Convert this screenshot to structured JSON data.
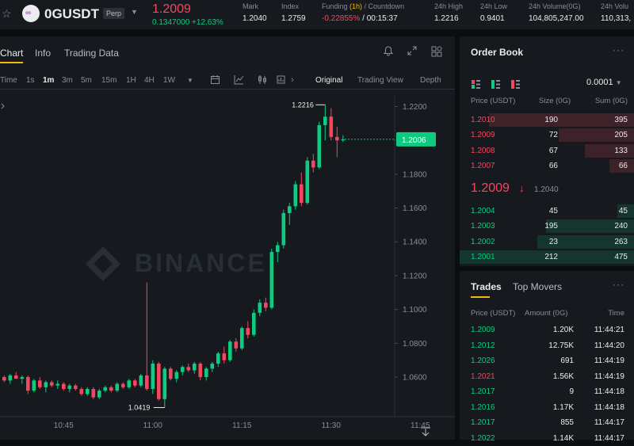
{
  "header": {
    "symbol": "0GUSDT",
    "contract_type": "Perp",
    "last_price": "1.2009",
    "change": "0.1347000 +12.63%",
    "stats": [
      {
        "label": "Mark",
        "value": "1.2040"
      },
      {
        "label": "Index",
        "value": "1.2759"
      },
      {
        "label_pre": "Funding ",
        "label_hl": "(1h)",
        "label_post": " / Countdown",
        "value": "-0.22855%",
        "value2": " / 00:15:37"
      },
      {
        "label": "24h High",
        "value": "1.2216"
      },
      {
        "label": "24h Low",
        "value": "0.9401"
      },
      {
        "label": "24h Volume(0G)",
        "value": "104,805,247.00"
      },
      {
        "label": "24h Volu",
        "value": "110,313,"
      }
    ]
  },
  "chart_panel": {
    "tabs": [
      "Chart",
      "Info",
      "Trading Data"
    ],
    "intervals": [
      "Time",
      "1s",
      "1m",
      "3m",
      "5m",
      "15m",
      "1H",
      "4H",
      "1W"
    ],
    "active_interval": "1m",
    "views": [
      "Original",
      "Trading View",
      "Depth"
    ],
    "active_view": "Original",
    "watermark": "BINANCE"
  },
  "chart_data": {
    "type": "candlestick",
    "interval": "1m",
    "y_ticks": [
      "1.2200",
      "1.2000",
      "1.1800",
      "1.1600",
      "1.1400",
      "1.1200",
      "1.1000",
      "1.0800",
      "1.0600"
    ],
    "x_ticks": [
      "10:45",
      "11:00",
      "11:15",
      "11:30",
      "11:45"
    ],
    "ylim": [
      1.0366,
      1.2263
    ],
    "current_price_label": "1.2006",
    "high_label": "1.2216",
    "low_label": "1.0419",
    "candles": [
      {
        "o": 1.06,
        "h": 1.061,
        "l": 1.057,
        "c": 1.058
      },
      {
        "o": 1.058,
        "h": 1.062,
        "l": 1.056,
        "c": 1.061
      },
      {
        "o": 1.061,
        "h": 1.063,
        "l": 1.059,
        "c": 1.059
      },
      {
        "o": 1.059,
        "h": 1.061,
        "l": 1.056,
        "c": 1.06
      },
      {
        "o": 1.06,
        "h": 1.061,
        "l": 1.05,
        "c": 1.052
      },
      {
        "o": 1.052,
        "h": 1.059,
        "l": 1.051,
        "c": 1.058
      },
      {
        "o": 1.058,
        "h": 1.06,
        "l": 1.053,
        "c": 1.054
      },
      {
        "o": 1.054,
        "h": 1.058,
        "l": 1.051,
        "c": 1.057
      },
      {
        "o": 1.057,
        "h": 1.058,
        "l": 1.054,
        "c": 1.055
      },
      {
        "o": 1.055,
        "h": 1.058,
        "l": 1.053,
        "c": 1.056
      },
      {
        "o": 1.056,
        "h": 1.057,
        "l": 1.052,
        "c": 1.053
      },
      {
        "o": 1.053,
        "h": 1.056,
        "l": 1.051,
        "c": 1.055
      },
      {
        "o": 1.055,
        "h": 1.056,
        "l": 1.052,
        "c": 1.053
      },
      {
        "o": 1.053,
        "h": 1.054,
        "l": 1.049,
        "c": 1.05
      },
      {
        "o": 1.05,
        "h": 1.054,
        "l": 1.049,
        "c": 1.053
      },
      {
        "o": 1.053,
        "h": 1.054,
        "l": 1.047,
        "c": 1.048
      },
      {
        "o": 1.048,
        "h": 1.053,
        "l": 1.047,
        "c": 1.052
      },
      {
        "o": 1.052,
        "h": 1.055,
        "l": 1.051,
        "c": 1.054
      },
      {
        "o": 1.054,
        "h": 1.055,
        "l": 1.051,
        "c": 1.052
      },
      {
        "o": 1.052,
        "h": 1.057,
        "l": 1.051,
        "c": 1.056
      },
      {
        "o": 1.056,
        "h": 1.057,
        "l": 1.053,
        "c": 1.054
      },
      {
        "o": 1.054,
        "h": 1.059,
        "l": 1.053,
        "c": 1.058
      },
      {
        "o": 1.058,
        "h": 1.059,
        "l": 1.054,
        "c": 1.055
      },
      {
        "o": 1.055,
        "h": 1.062,
        "l": 1.054,
        "c": 1.061
      },
      {
        "o": 1.061,
        "h": 1.116,
        "l": 1.052,
        "c": 1.053
      },
      {
        "o": 1.053,
        "h": 1.07,
        "l": 1.05,
        "c": 1.068
      },
      {
        "o": 1.068,
        "h": 1.069,
        "l": 1.046,
        "c": 1.047
      },
      {
        "o": 1.047,
        "h": 1.066,
        "l": 1.042,
        "c": 1.065
      },
      {
        "o": 1.065,
        "h": 1.066,
        "l": 1.058,
        "c": 1.059
      },
      {
        "o": 1.059,
        "h": 1.064,
        "l": 1.057,
        "c": 1.063
      },
      {
        "o": 1.063,
        "h": 1.067,
        "l": 1.061,
        "c": 1.066
      },
      {
        "o": 1.066,
        "h": 1.068,
        "l": 1.063,
        "c": 1.064
      },
      {
        "o": 1.064,
        "h": 1.069,
        "l": 1.062,
        "c": 1.068
      },
      {
        "o": 1.068,
        "h": 1.069,
        "l": 1.058,
        "c": 1.06
      },
      {
        "o": 1.06,
        "h": 1.066,
        "l": 1.058,
        "c": 1.065
      },
      {
        "o": 1.065,
        "h": 1.069,
        "l": 1.063,
        "c": 1.068
      },
      {
        "o": 1.068,
        "h": 1.075,
        "l": 1.066,
        "c": 1.074
      },
      {
        "o": 1.074,
        "h": 1.078,
        "l": 1.068,
        "c": 1.07
      },
      {
        "o": 1.07,
        "h": 1.082,
        "l": 1.069,
        "c": 1.081
      },
      {
        "o": 1.081,
        "h": 1.083,
        "l": 1.075,
        "c": 1.077
      },
      {
        "o": 1.077,
        "h": 1.09,
        "l": 1.076,
        "c": 1.089
      },
      {
        "o": 1.089,
        "h": 1.093,
        "l": 1.083,
        "c": 1.085
      },
      {
        "o": 1.085,
        "h": 1.1,
        "l": 1.084,
        "c": 1.098
      },
      {
        "o": 1.098,
        "h": 1.106,
        "l": 1.096,
        "c": 1.104
      },
      {
        "o": 1.104,
        "h": 1.107,
        "l": 1.099,
        "c": 1.101
      },
      {
        "o": 1.101,
        "h": 1.136,
        "l": 1.1,
        "c": 1.134
      },
      {
        "o": 1.134,
        "h": 1.14,
        "l": 1.128,
        "c": 1.138
      },
      {
        "o": 1.138,
        "h": 1.159,
        "l": 1.136,
        "c": 1.157
      },
      {
        "o": 1.157,
        "h": 1.163,
        "l": 1.15,
        "c": 1.161
      },
      {
        "o": 1.161,
        "h": 1.176,
        "l": 1.159,
        "c": 1.174
      },
      {
        "o": 1.174,
        "h": 1.181,
        "l": 1.161,
        "c": 1.163
      },
      {
        "o": 1.163,
        "h": 1.19,
        "l": 1.162,
        "c": 1.188
      },
      {
        "o": 1.188,
        "h": 1.192,
        "l": 1.181,
        "c": 1.184
      },
      {
        "o": 1.184,
        "h": 1.211,
        "l": 1.183,
        "c": 1.209
      },
      {
        "o": 1.209,
        "h": 1.221,
        "l": 1.2,
        "c": 1.214
      },
      {
        "o": 1.214,
        "h": 1.219,
        "l": 1.2,
        "c": 1.202
      },
      {
        "o": 1.202,
        "h": 1.208,
        "l": 1.19,
        "c": 1.2
      },
      {
        "o": 1.2,
        "h": 1.203,
        "l": 1.199,
        "c": 1.2006
      }
    ]
  },
  "order_book": {
    "title": "Order Book",
    "precision": "0.0001",
    "headers": [
      "Price (USDT)",
      "Size (0G)",
      "Sum (0G)"
    ],
    "asks": [
      {
        "price": "1.2010",
        "size": "190",
        "sum": "395",
        "depth": 0.8316
      },
      {
        "price": "1.2009",
        "size": "72",
        "sum": "205",
        "depth": 0.4316
      },
      {
        "price": "1.2008",
        "size": "67",
        "sum": "133",
        "depth": 0.28
      },
      {
        "price": "1.2007",
        "size": "66",
        "sum": "66",
        "depth": 0.1389
      }
    ],
    "mid_price": "1.2009",
    "mid_arrow": "↓",
    "mark_price": "1.2040",
    "bids": [
      {
        "price": "1.2004",
        "size": "45",
        "sum": "45",
        "depth": 0.0947
      },
      {
        "price": "1.2003",
        "size": "195",
        "sum": "240",
        "depth": 0.5053
      },
      {
        "price": "1.2002",
        "size": "23",
        "sum": "263",
        "depth": 0.5537
      },
      {
        "price": "1.2001",
        "size": "212",
        "sum": "475",
        "depth": 1.0
      }
    ]
  },
  "trades": {
    "tabs": [
      "Trades",
      "Top Movers"
    ],
    "headers": [
      "Price (USDT)",
      "Amount (0G)",
      "Time"
    ],
    "rows": [
      {
        "price": "1.2009",
        "amount": "1.20K",
        "time": "11:44:21",
        "side": "buy"
      },
      {
        "price": "1.2012",
        "amount": "12.75K",
        "time": "11:44:20",
        "side": "buy"
      },
      {
        "price": "1.2026",
        "amount": "691",
        "time": "11:44:19",
        "side": "buy"
      },
      {
        "price": "1.2021",
        "amount": "1.56K",
        "time": "11:44:19",
        "side": "sell"
      },
      {
        "price": "1.2017",
        "amount": "9",
        "time": "11:44:18",
        "side": "buy"
      },
      {
        "price": "1.2016",
        "amount": "1.17K",
        "time": "11:44:18",
        "side": "buy"
      },
      {
        "price": "1.2017",
        "amount": "855",
        "time": "11:44:17",
        "side": "buy"
      },
      {
        "price": "1.2022",
        "amount": "1.14K",
        "time": "11:44:17",
        "side": "buy"
      }
    ]
  },
  "colors": {
    "up": "#0ecb81",
    "down": "#f6465d",
    "accent": "#f0b90b",
    "panel": "#161a1e",
    "background": "#0b0e11"
  }
}
